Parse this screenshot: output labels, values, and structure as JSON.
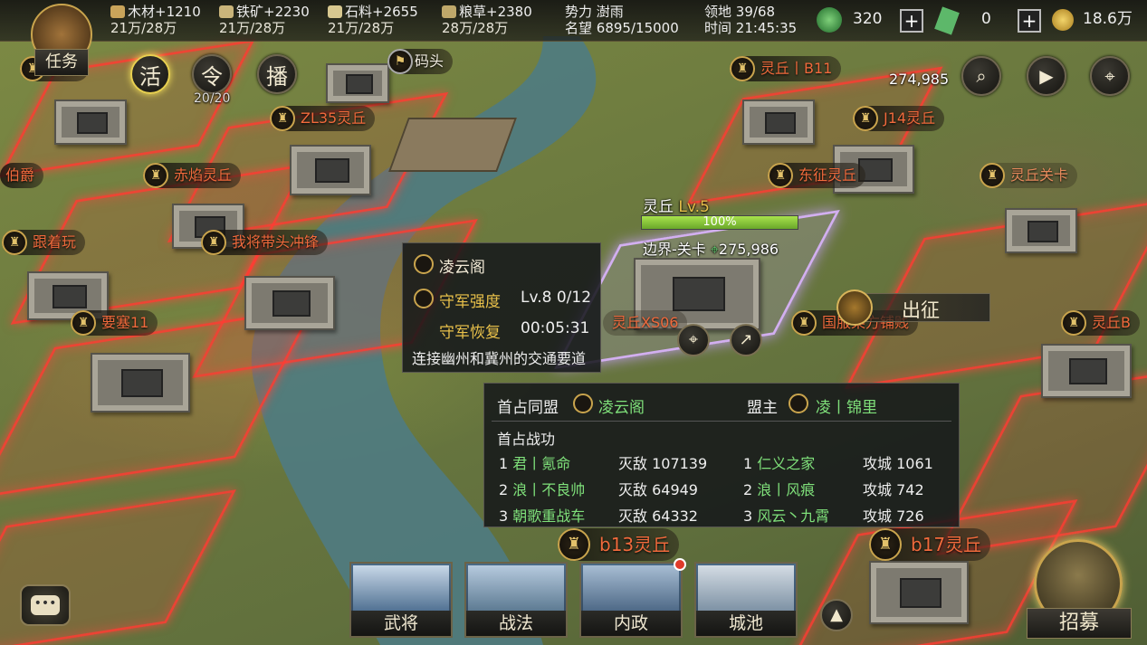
{
  "resources": {
    "wood": {
      "gain": "木材+1210",
      "cap": "21万/28万"
    },
    "iron": {
      "gain": "铁矿+2230",
      "cap": "21万/28万"
    },
    "stone": {
      "gain": "石料+2655",
      "cap": "21万/28万"
    },
    "grain": {
      "gain": "粮草+2380",
      "cap": "28万/28万"
    }
  },
  "status": {
    "faction_label": "势力",
    "faction": "澍雨",
    "fame_label": "名望",
    "fame": "6895/15000",
    "territory_label": "领地",
    "territory": "39/68",
    "time_label": "时间",
    "time": "21:45:35"
  },
  "currency": {
    "jade": "320",
    "ticket": "0",
    "copper": "18.6万"
  },
  "left_buttons": {
    "task": "任务",
    "active": "活",
    "order": "令",
    "order_count": "20/20",
    "broadcast": "播"
  },
  "right_buttons": {
    "number": "274,985"
  },
  "map_labels": [
    {
      "text": "灵丘",
      "kind": "red"
    },
    {
      "text": "码头",
      "kind": "white"
    },
    {
      "text": "ZL35灵丘",
      "kind": "red"
    },
    {
      "text": "赤焰灵丘",
      "kind": "red"
    },
    {
      "text": "伯爵",
      "kind": "red"
    },
    {
      "text": "跟着玩",
      "kind": "red"
    },
    {
      "text": "我将带头冲锋",
      "kind": "red"
    },
    {
      "text": "要塞11",
      "kind": "red"
    },
    {
      "text": "灵丘丨B11",
      "kind": "red"
    },
    {
      "text": "J14灵丘",
      "kind": "red"
    },
    {
      "text": "东征灵丘",
      "kind": "red"
    },
    {
      "text": "灵丘关卡",
      "kind": "red"
    },
    {
      "text": "灵丘XS06",
      "kind": "red"
    },
    {
      "text": "国服某方铺贱",
      "kind": "red"
    },
    {
      "text": "灵丘B",
      "kind": "red"
    },
    {
      "text": "b13灵丘",
      "kind": "red"
    },
    {
      "text": "b17灵丘",
      "kind": "red"
    }
  ],
  "city_info": {
    "name": "灵丘",
    "level": "Lv.5",
    "progress": "100%",
    "progress_value": 1.0,
    "type": "边界-关卡",
    "power": "275,986"
  },
  "tooltip": {
    "alliance": "凌云阁",
    "defense_label": "守军强度",
    "defense_level": "Lv.8",
    "defense_value": "0/12",
    "recover_label": "守军恢复",
    "recover_time": "00:05:31",
    "description": "连接幽州和冀州的交通要道"
  },
  "march_button": "出征",
  "first_occupy": {
    "alliance_label": "首占同盟",
    "alliance": "凌云阁",
    "leader_label": "盟主",
    "leader": "凌丨锦里",
    "merit_label": "首占战功",
    "kills": [
      {
        "rank": "1",
        "name": "君丨氪命",
        "value": "灭敌 107139"
      },
      {
        "rank": "2",
        "name": "浪丨不良帅",
        "value": "灭敌 64949"
      },
      {
        "rank": "3",
        "name": "朝歌重战车",
        "value": "灭敌 64332"
      }
    ],
    "sieges": [
      {
        "rank": "1",
        "name": "仁义之家",
        "value": "攻城 1061"
      },
      {
        "rank": "2",
        "name": "浪丨风痕",
        "value": "攻城 742"
      },
      {
        "rank": "3",
        "name": "风云丶九霄",
        "value": "攻城 726"
      }
    ]
  },
  "bottom_tabs": [
    "武将",
    "战法",
    "内政",
    "城池"
  ],
  "recruit": "招募",
  "colors": {
    "accent_gold": "#c9a44d",
    "enemy_red": "#f06a3c",
    "ally_green": "#7fe07a",
    "progress": "#8fd23d"
  }
}
